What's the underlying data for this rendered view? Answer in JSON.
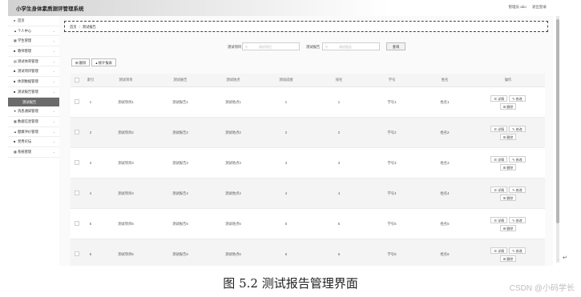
{
  "app": {
    "title": "小学生身体素质测评管理系统",
    "user_label": "管理员 abo",
    "logout_label": "退出登录"
  },
  "sidebar": {
    "items": [
      {
        "icon": "home-icon",
        "glyph": "♠",
        "label": "首页",
        "has_arrow": false
      },
      {
        "icon": "user-icon",
        "glyph": "▲",
        "label": "个人中心",
        "has_arrow": true
      },
      {
        "icon": "grid-icon",
        "glyph": "▦",
        "label": "学生管理",
        "has_arrow": true
      },
      {
        "icon": "teacher-icon",
        "glyph": "■",
        "label": "教师管理",
        "has_arrow": true
      },
      {
        "icon": "list-icon",
        "glyph": "▤",
        "label": "测试体育管理",
        "has_arrow": true
      },
      {
        "icon": "list-icon",
        "glyph": "■",
        "label": "测试项目管理",
        "has_arrow": true
      },
      {
        "icon": "list-icon",
        "glyph": "■",
        "label": "体测数据管理",
        "has_arrow": true
      },
      {
        "icon": "list-icon",
        "glyph": "■",
        "label": "测试报告管理",
        "has_arrow": true
      },
      {
        "icon": "",
        "glyph": "",
        "label": "测试报告",
        "has_arrow": false,
        "sub": true
      },
      {
        "icon": "send-icon",
        "glyph": "➤",
        "label": "消息通知管理",
        "has_arrow": true
      },
      {
        "icon": "grid-icon",
        "glyph": "▦",
        "label": "数据信息管理",
        "has_arrow": true
      },
      {
        "icon": "user-icon",
        "glyph": "▲",
        "label": "健康评价管理",
        "has_arrow": true
      },
      {
        "icon": "book-icon",
        "glyph": "■",
        "label": "党用论坛",
        "has_arrow": true
      },
      {
        "icon": "grid-icon",
        "glyph": "▦",
        "label": "系统管理",
        "has_arrow": true
      }
    ]
  },
  "breadcrumb": {
    "home": "首页",
    "current": "测试报告"
  },
  "search": {
    "label1": "测试项目",
    "placeholder1": "测试项目",
    "label2": "测试报告",
    "placeholder2": "测试报告",
    "button": "查询"
  },
  "actions": {
    "delete": "删除",
    "stats": "统计报表"
  },
  "table": {
    "headers": [
      "",
      "索引",
      "测试项目",
      "测试报告",
      "测试地点",
      "测试成绩",
      "排名",
      "学号",
      "姓名",
      "操作"
    ],
    "rows": [
      {
        "idx": "1",
        "item": "测试项目1",
        "report": "测试报告1",
        "place": "测试地点1",
        "score": "1",
        "rank": "1",
        "sno": "学号1",
        "name": "姓名1"
      },
      {
        "idx": "2",
        "item": "测试项目2",
        "report": "测试报告2",
        "place": "测试地点2",
        "score": "2",
        "rank": "2",
        "sno": "学号2",
        "name": "姓名2"
      },
      {
        "idx": "3",
        "item": "测试项目3",
        "report": "测试报告3",
        "place": "测试地点3",
        "score": "3",
        "rank": "3",
        "sno": "学号3",
        "name": "姓名3"
      },
      {
        "idx": "4",
        "item": "测试项目4",
        "report": "测试报告4",
        "place": "测试地点4",
        "score": "4",
        "rank": "4",
        "sno": "学号4",
        "name": "姓名4"
      },
      {
        "idx": "5",
        "item": "测试项目5",
        "report": "测试报告5",
        "place": "测试地点5",
        "score": "5",
        "rank": "5",
        "sno": "学号5",
        "name": "姓名5"
      },
      {
        "idx": "6",
        "item": "测试项目6",
        "report": "测试报告6",
        "place": "测试地点6",
        "score": "6",
        "rank": "6",
        "sno": "学号6",
        "name": "姓名6"
      }
    ],
    "op_detail": "详情",
    "op_edit": "修改",
    "op_delete": "删除"
  },
  "caption": "图 5.2 测试报告管理界面",
  "watermark": "CSDN @小码学长"
}
